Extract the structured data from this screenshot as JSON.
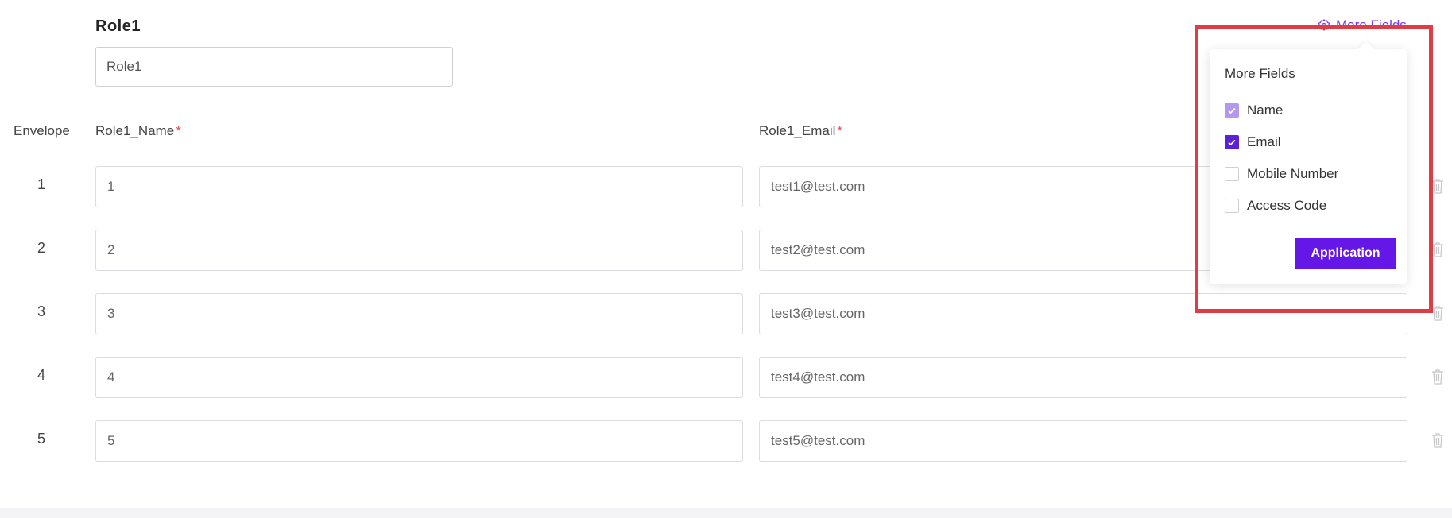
{
  "role": {
    "title": "Role1",
    "input_value": "Role1"
  },
  "columns": {
    "envelope": "Envelope",
    "name": "Role1_Name",
    "email": "Role1_Email",
    "required_mark": "*"
  },
  "rows": [
    {
      "envelope": "1",
      "name": "1",
      "email": "test1@test.com"
    },
    {
      "envelope": "2",
      "name": "2",
      "email": "test2@test.com"
    },
    {
      "envelope": "3",
      "name": "3",
      "email": "test3@test.com"
    },
    {
      "envelope": "4",
      "name": "4",
      "email": "test4@test.com"
    },
    {
      "envelope": "5",
      "name": "5",
      "email": "test5@test.com"
    }
  ],
  "more_fields": {
    "link_label": "More Fields",
    "popover_title": "More Fields",
    "options": [
      {
        "label": "Name",
        "state": "checked-disabled"
      },
      {
        "label": "Email",
        "state": "checked"
      },
      {
        "label": "Mobile Number",
        "state": "unchecked"
      },
      {
        "label": "Access Code",
        "state": "unchecked"
      }
    ],
    "apply_label": "Application"
  },
  "icons": {
    "more_fields": "gear-icon",
    "row_delete": "trash-icon"
  },
  "colors": {
    "accent": "#6417e6",
    "link": "#7c3aed",
    "required": "#e5484d",
    "highlight": "#e03c45"
  }
}
